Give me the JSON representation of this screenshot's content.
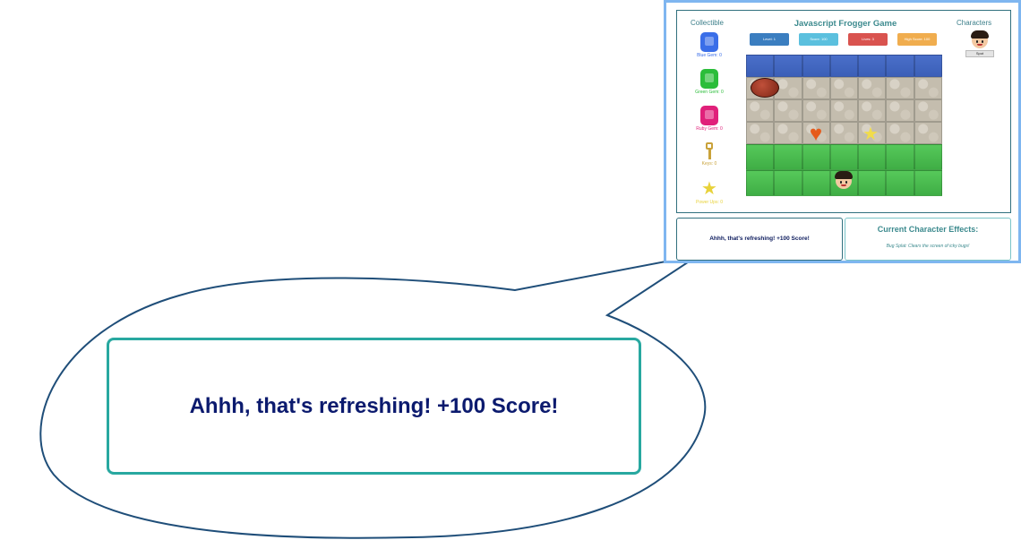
{
  "colors": {
    "frame_border": "#7fb6f0",
    "panel_border": "#31707e",
    "callout_outline": "#1f4e79",
    "callout_box_border": "#28a8a0",
    "callout_text": "#0b1a6e"
  },
  "game": {
    "collectible_header": "Collectible",
    "title": "Javascript Frogger Game",
    "characters_header": "Characters",
    "stats": {
      "level": "Level: 1",
      "score": "Score: 100",
      "lives": "Lives: 3",
      "high_score": "High Score: 100"
    },
    "collectibles": [
      {
        "icon": "blue-gem-icon",
        "label": "Blue Gem: 0",
        "color": "#3a6ee8"
      },
      {
        "icon": "green-gem-icon",
        "label": "Green Gem: 0",
        "color": "#2bbd3a"
      },
      {
        "icon": "ruby-gem-icon",
        "label": "Ruby Gem: 0",
        "color": "#e0207a"
      },
      {
        "icon": "key-icon",
        "label": "Keys: 0",
        "color": "#c9a23a"
      },
      {
        "icon": "star-icon",
        "label": "Power Ups: 0",
        "color": "#e8d23a"
      }
    ],
    "character_select_label": "Spot"
  },
  "message": {
    "text": "Ahhh, that's refreshing! +100 Score!"
  },
  "effects": {
    "heading": "Current Character Effects:",
    "body": "Bug Splat: Clears the screen of icky bugs!"
  },
  "callout": {
    "text": "Ahhh, that's refreshing! +100 Score!"
  }
}
